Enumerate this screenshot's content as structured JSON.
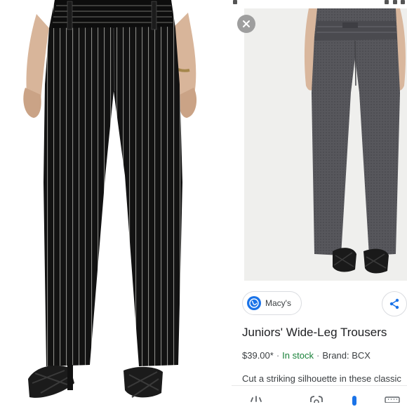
{
  "merchant": {
    "name": "Macy's"
  },
  "product": {
    "title": "Juniors' Wide-Leg Trousers",
    "price": "$39.00*",
    "stock": "In stock",
    "brand": "Brand: BCX",
    "separator": "·",
    "description": "Cut a striking silhouette in these classic"
  },
  "icons": {
    "close": "close-icon",
    "merchant": "globe-icon",
    "share": "share-icon",
    "bottom": [
      "lens-sparkle-icon",
      "lens-icon",
      "mic-icon",
      "keyboard-icon"
    ]
  },
  "colors": {
    "accent": "#1a73e8",
    "stock": "#188038",
    "pinstripe_pants": "#141414",
    "gray_pants": "#55555a"
  }
}
